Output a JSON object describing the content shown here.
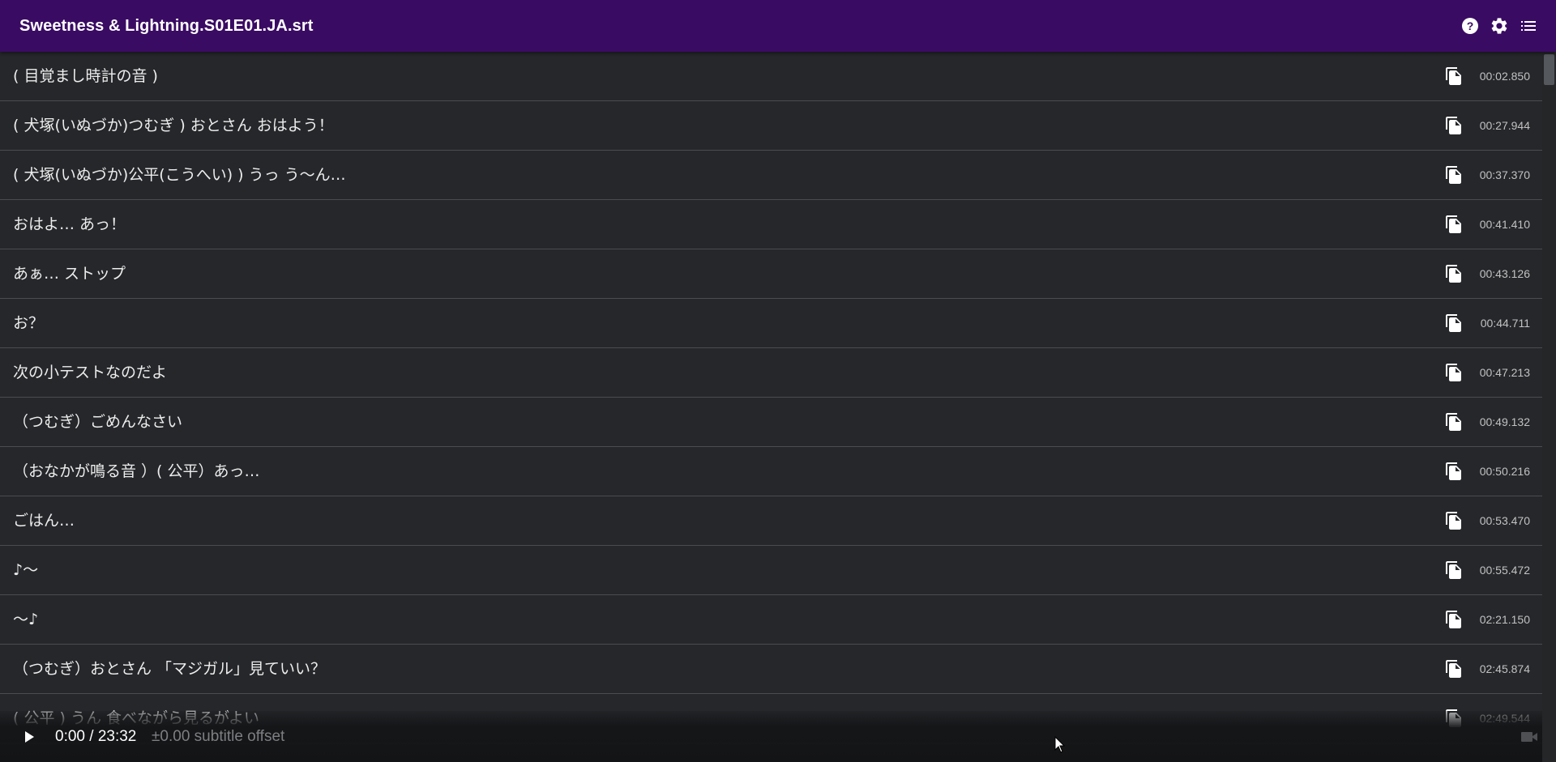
{
  "app": {
    "title": "Sweetness & Lightning.S01E01.JA.srt",
    "icons": [
      "help-icon",
      "settings-icon",
      "list-icon"
    ]
  },
  "subtitles": [
    {
      "text": "( 目覚まし時計の音 )",
      "time": "00:02.850"
    },
    {
      "text": "( 犬塚(いぬづか)つむぎ ) おとさん おはよう！",
      "time": "00:27.944"
    },
    {
      "text": "( 犬塚(いぬづか)公平(こうへい) ) うっ う～ん…",
      "time": "00:37.370"
    },
    {
      "text": "おはよ… あっ！",
      "time": "00:41.410"
    },
    {
      "text": "あぁ… ストップ",
      "time": "00:43.126"
    },
    {
      "text": "お？",
      "time": "00:44.711"
    },
    {
      "text": "次の小テストなのだよ",
      "time": "00:47.213"
    },
    {
      "text": "（つむぎ）ごめんなさい",
      "time": "00:49.132"
    },
    {
      "text": "（おなかが鳴る音 ）( 公平）あっ…",
      "time": "00:50.216"
    },
    {
      "text": "ごはん…",
      "time": "00:53.470"
    },
    {
      "text": "♪〜",
      "time": "00:55.472"
    },
    {
      "text": "〜♪",
      "time": "02:21.150"
    },
    {
      "text": "（つむぎ）おとさん 「マジガル」見ていい？",
      "time": "02:45.874"
    },
    {
      "text": "( 公平 ) うん 食べながら見るがよい",
      "time": "02:49.544"
    }
  ],
  "player": {
    "time": "0:00 / 23:32",
    "offset": "±0.00 subtitle offset"
  },
  "colors": {
    "appbar": "#3a0b63",
    "background": "#25272a",
    "row_divider": "#4a4c50"
  }
}
